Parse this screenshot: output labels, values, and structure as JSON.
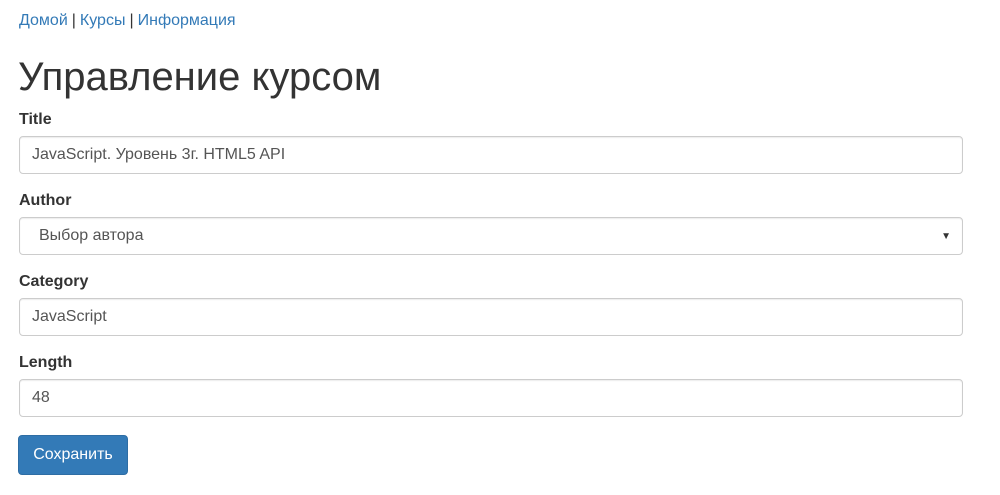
{
  "nav": {
    "home": "Домой",
    "courses": "Курсы",
    "info": "Информация",
    "separator": "|"
  },
  "page": {
    "title": "Управление курсом"
  },
  "form": {
    "title": {
      "label": "Title",
      "value": "JavaScript. Уровень 3г. HTML5 API"
    },
    "author": {
      "label": "Author",
      "selected": "Выбор автора",
      "icon": "caret-down-icon"
    },
    "category": {
      "label": "Category",
      "value": "JavaScript"
    },
    "length": {
      "label": "Length",
      "value": "48"
    },
    "save_label": "Сохранить"
  },
  "colors": {
    "link": "#337ab7",
    "primary_button": "#337ab7",
    "text": "#333333",
    "input_border": "#cccccc"
  }
}
